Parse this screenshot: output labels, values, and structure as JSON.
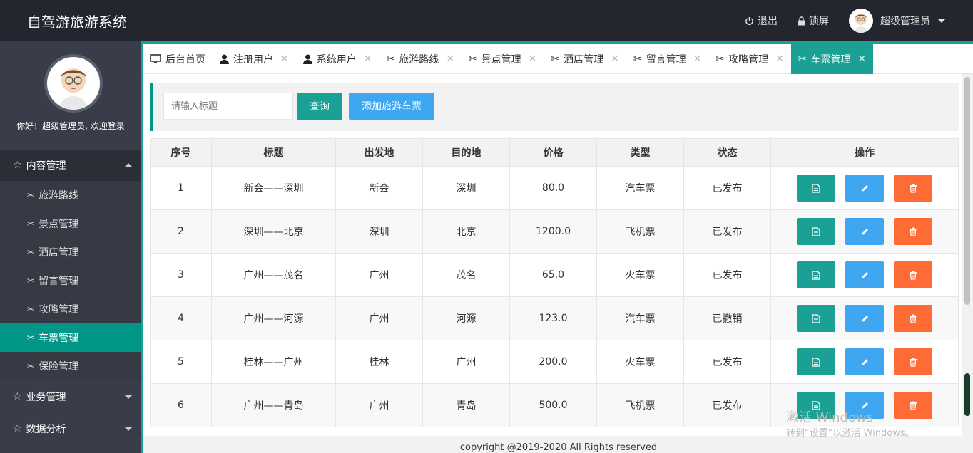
{
  "header": {
    "title": "自驾游旅游系统",
    "logout_label": "退出",
    "lock_label": "锁屏",
    "user_name": "超级管理员"
  },
  "sidebar": {
    "welcome": "你好！超级管理员, 欢迎登录",
    "groups": [
      {
        "label": "内容管理",
        "expanded": true
      },
      {
        "label": "业务管理",
        "expanded": false
      },
      {
        "label": "数据分析",
        "expanded": false
      }
    ],
    "items": [
      {
        "label": "旅游路线"
      },
      {
        "label": "景点管理"
      },
      {
        "label": "酒店管理"
      },
      {
        "label": "留言管理"
      },
      {
        "label": "攻略管理"
      },
      {
        "label": "车票管理",
        "active": true
      },
      {
        "label": "保险管理"
      }
    ]
  },
  "tabs": [
    {
      "label": "后台首页",
      "icon": "monitor-icon"
    },
    {
      "label": "注册用户",
      "icon": "user-icon"
    },
    {
      "label": "系统用户",
      "icon": "user-icon"
    },
    {
      "label": "旅游路线",
      "icon": "tools-icon"
    },
    {
      "label": "景点管理",
      "icon": "tools-icon"
    },
    {
      "label": "酒店管理",
      "icon": "tools-icon"
    },
    {
      "label": "留言管理",
      "icon": "tools-icon"
    },
    {
      "label": "攻略管理",
      "icon": "tools-icon"
    },
    {
      "label": "车票管理",
      "icon": "tools-icon",
      "active": true
    }
  ],
  "toolbar": {
    "search_placeholder": "请输入标题",
    "query_label": "查询",
    "add_label": "添加旅游车票"
  },
  "table": {
    "headers": [
      "序号",
      "标题",
      "出发地",
      "目的地",
      "价格",
      "类型",
      "状态",
      "操作"
    ],
    "rows": [
      [
        "1",
        "新会——深圳",
        "新会",
        "深圳",
        "80.0",
        "汽车票",
        "已发布"
      ],
      [
        "2",
        "深圳——北京",
        "深圳",
        "北京",
        "1200.0",
        "飞机票",
        "已发布"
      ],
      [
        "3",
        "广州——茂名",
        "广州",
        "茂名",
        "65.0",
        "火车票",
        "已发布"
      ],
      [
        "4",
        "广州——河源",
        "广州",
        "河源",
        "123.0",
        "汽车票",
        "已撤销"
      ],
      [
        "5",
        "桂林——广州",
        "桂林",
        "广州",
        "200.0",
        "火车票",
        "已发布"
      ],
      [
        "6",
        "广州——青岛",
        "广州",
        "青岛",
        "500.0",
        "飞机票",
        "已发布"
      ]
    ]
  },
  "footer": {
    "text": "copyright @2019-2020 All Rights reserved"
  },
  "watermark": {
    "line1": "激活 Windows",
    "line2": "转到“设置”以激活 Windows。"
  },
  "colors": {
    "accent": "#009688",
    "header_bg": "#23262e",
    "sidebar_bg": "#393d49",
    "edit_blue": "#3fa7f2",
    "delete_orange": "#ff6b35"
  }
}
